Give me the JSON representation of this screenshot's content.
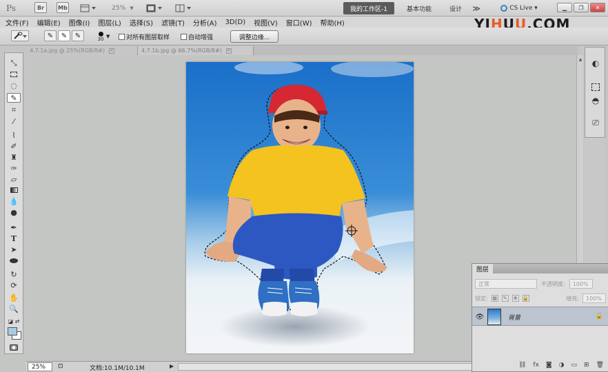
{
  "titlebar": {
    "ps_logo": "Ps",
    "bridge": "Br",
    "minibridge": "Mb",
    "zoom": "25%",
    "workspace_active": "我的工作区-1",
    "workspace_basic": "基本功能",
    "workspace_design": "设计",
    "workspace_more": "≫",
    "cs_live": "CS Live ▾"
  },
  "menu": {
    "items": [
      "文件(F)",
      "编辑(E)",
      "图像(I)",
      "图层(L)",
      "选择(S)",
      "滤镜(T)",
      "分析(A)",
      "3D(D)",
      "视图(V)",
      "窗口(W)",
      "帮助(H)"
    ]
  },
  "watermark": {
    "a": "YI",
    "b": "H",
    "c": "U",
    "d": "U",
    "e": ".COM"
  },
  "options": {
    "brush_size": "30",
    "sample_all": "对所有图层取样",
    "auto_enhance": "自动增强",
    "refine_edge": "调整边缘..."
  },
  "documents": {
    "tabs": [
      "4.7.1a.jpg @ 25%(RGB/8#)",
      "4.7.1b.jpg @ 66.7%(RGB/8#)"
    ]
  },
  "status": {
    "zoom": "25%",
    "doc_size": "文档:10.1M/10.1M"
  },
  "layers_panel": {
    "tab": "图层",
    "blend_mode": "正常",
    "opacity_label": "不透明度:",
    "opacity_value": "100%",
    "lock_label": "锁定:",
    "fill_label": "填充:",
    "fill_value": "100%",
    "layer_name": "背景"
  },
  "colors": {
    "foreground": "#a9cbe4",
    "background": "#ffffff",
    "workspace_active_bg": "#5b5b5b",
    "watermark_accent": "#e85c2a"
  }
}
